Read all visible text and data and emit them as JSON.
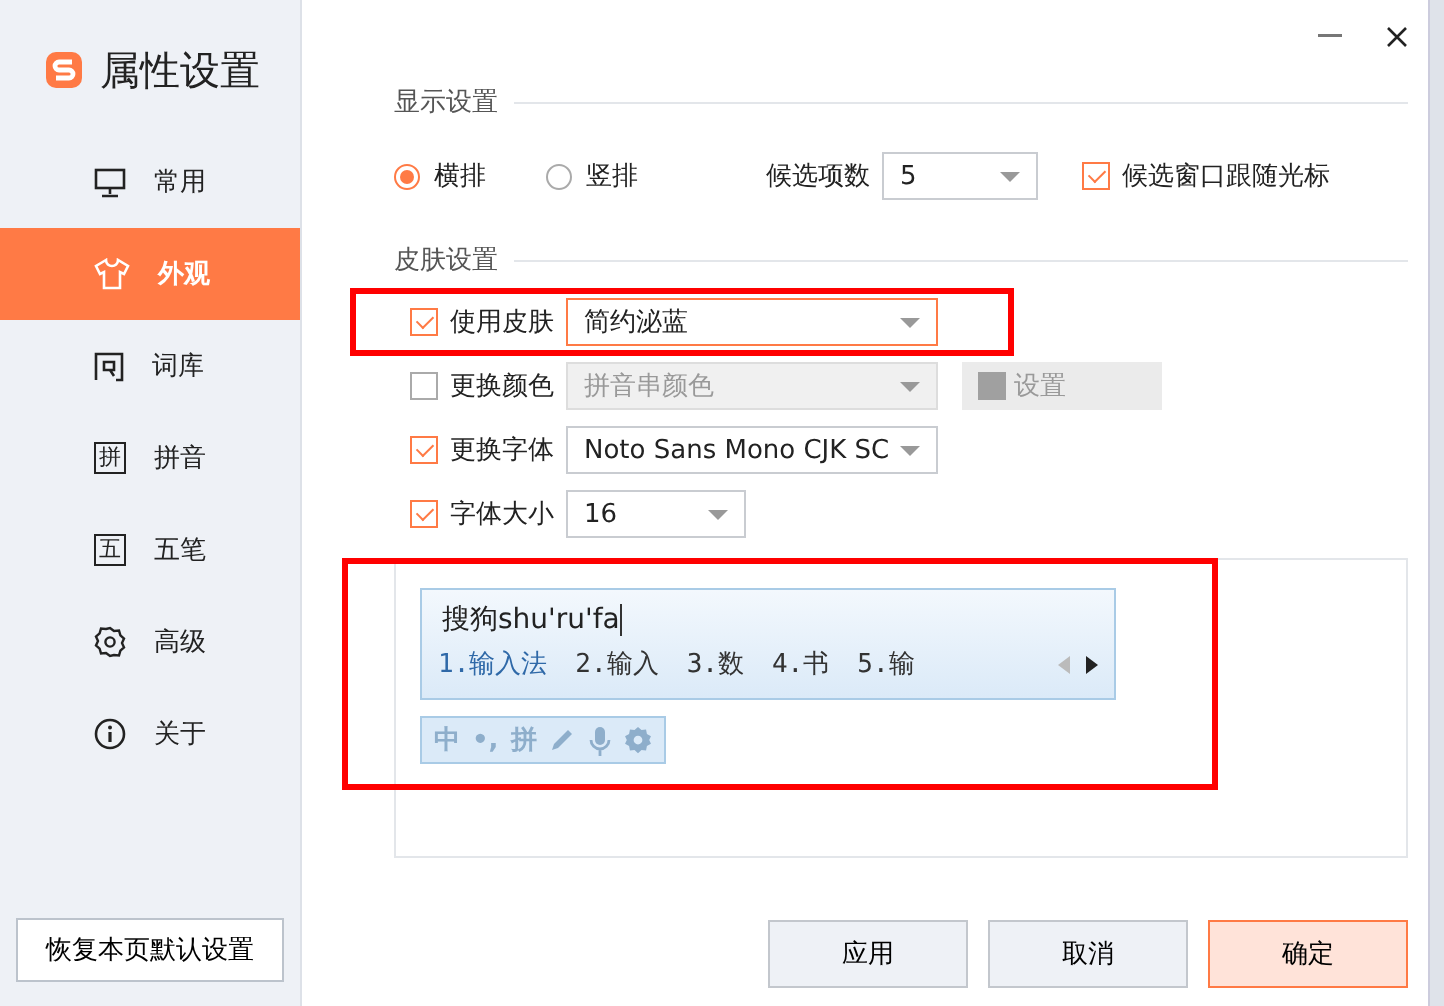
{
  "sidebar": {
    "title": "属性设置",
    "items": [
      {
        "label": "常用",
        "kind": "monitor",
        "selected": false
      },
      {
        "label": "外观",
        "kind": "shirt",
        "selected": true
      },
      {
        "label": "词库",
        "kind": "dict",
        "selected": false
      },
      {
        "label": "拼音",
        "kind": "glyph",
        "glyph": "拼",
        "selected": false
      },
      {
        "label": "五笔",
        "kind": "glyph",
        "glyph": "五",
        "selected": false
      },
      {
        "label": "高级",
        "kind": "gear",
        "selected": false
      },
      {
        "label": "关于",
        "kind": "info",
        "selected": false
      }
    ],
    "reset_button": "恢复本页默认设置"
  },
  "display_settings": {
    "title": "显示设置",
    "layout_options": [
      {
        "label": "横排",
        "selected": true
      },
      {
        "label": "竖排",
        "selected": false
      }
    ],
    "candidate_count": {
      "label": "候选项数",
      "value": "5"
    },
    "follow_cursor": {
      "label": "候选窗口跟随光标",
      "checked": true
    }
  },
  "skin_settings": {
    "title": "皮肤设置",
    "rows": [
      {
        "label": "使用皮肤",
        "checked": true,
        "value": "简约泌蓝",
        "highlighted": true
      },
      {
        "label": "更换颜色",
        "checked": false,
        "value": "拼音串颜色",
        "button": "设置",
        "highlighted": false
      },
      {
        "label": "更换字体",
        "checked": true,
        "value": "Noto Sans Mono CJK SC",
        "highlighted": false
      },
      {
        "label": "字体大小",
        "checked": true,
        "value": "16",
        "highlighted": false
      }
    ]
  },
  "preview": {
    "highlighted": true,
    "composition": "搜狗shu'ru'fa",
    "candidates": [
      {
        "text": "1.输入法",
        "selected": true
      },
      {
        "text": "2.输入",
        "selected": false
      },
      {
        "text": "3.数",
        "selected": false
      },
      {
        "text": "4.书",
        "selected": false
      },
      {
        "text": "5.输",
        "selected": false
      }
    ],
    "toolbar": [
      "中",
      "•,",
      "拼"
    ]
  },
  "buttons": [
    {
      "label": "应用",
      "primary": false
    },
    {
      "label": "取消",
      "primary": false
    },
    {
      "label": "确定",
      "primary": true
    }
  ]
}
